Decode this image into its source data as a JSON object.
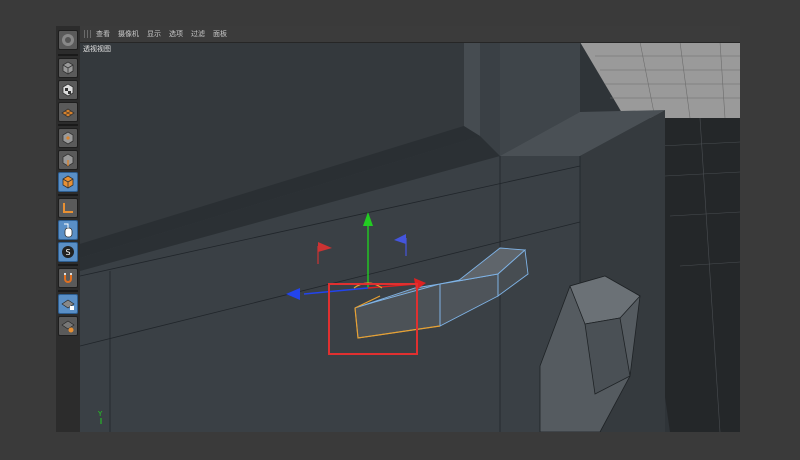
{
  "menu": {
    "items": [
      "查看",
      "摄像机",
      "显示",
      "选项",
      "过滤",
      "面板"
    ]
  },
  "viewport": {
    "label": "透视视图",
    "axis_label": "Y"
  },
  "toolbar": {
    "items": [
      {
        "name": "logo-icon",
        "active": false
      },
      {
        "name": "model-mode-icon",
        "active": false
      },
      {
        "name": "texture-mode-icon",
        "active": false
      },
      {
        "name": "workplane-icon",
        "active": false
      },
      {
        "name": "point-mode-icon",
        "active": false
      },
      {
        "name": "edge-mode-icon",
        "active": false
      },
      {
        "name": "polygon-mode-icon",
        "active": true
      },
      {
        "name": "axis-mode-icon",
        "active": false
      },
      {
        "name": "tweak-mode-icon",
        "active": true
      },
      {
        "name": "solo-icon",
        "active": true
      },
      {
        "name": "snap-magnet-icon",
        "active": false
      },
      {
        "name": "locked-workplane-icon",
        "active": true
      },
      {
        "name": "planar-workplane-icon",
        "active": false
      }
    ]
  },
  "colors": {
    "selection_highlight": "#e03030",
    "axis_y": "#22cc22",
    "axis_x": "#dd2222",
    "axis_z": "#2244ee",
    "selected_edge": "#e8a030",
    "active_tool": "#5a8fc6"
  }
}
